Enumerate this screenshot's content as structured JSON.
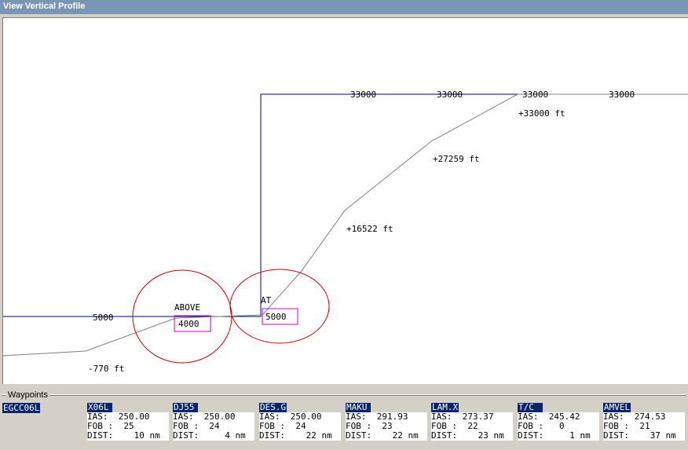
{
  "window": {
    "title": "View Vertical Profile"
  },
  "colors": {
    "profile_line": "#00008b",
    "descent_path": "#808080",
    "constraint_circle": "#cc0000",
    "constraint_box": "#cc00cc",
    "selected": "#08246b"
  },
  "profile": {
    "altitude_labels": [
      "33000",
      "33000",
      "33000",
      "33000"
    ],
    "left_altitude_label": "5000",
    "altitude_callouts": [
      "+33000 ft",
      "+27259 ft",
      "+16522 ft",
      "-770 ft"
    ],
    "constraints": [
      {
        "type_label": "ABOVE",
        "altitude": "4000"
      },
      {
        "type_label": "AT",
        "altitude": "5000"
      }
    ]
  },
  "waypoints_panel": {
    "legend": "Waypoints",
    "origin": "EGCC06L",
    "items": [
      {
        "name": "X06L",
        "ias": "IAS:  250.00",
        "fob": "FOB :  25",
        "dist": "DIST:    10 nm"
      },
      {
        "name": "DJ55",
        "ias": "IAS:  250.00",
        "fob": "FOB :  24",
        "dist": "DIST:     4 nm"
      },
      {
        "name": "DES.G",
        "ias": "IAS:  250.00",
        "fob": "FOB :  24",
        "dist": "DIST:    22 nm"
      },
      {
        "name": "MAKU",
        "ias": "IAS:  291.93",
        "fob": "FOB :  23",
        "dist": "DIST:    22 nm"
      },
      {
        "name": "LAM.X",
        "ias": "IAS:  273.37",
        "fob": "FOB :  22",
        "dist": "DIST:    23 nm"
      },
      {
        "name": "T/C",
        "ias": "IAS:  245.42",
        "fob": "FOB :   0",
        "dist": "DIST:     1 nm"
      },
      {
        "name": "AMVEL",
        "ias": "IAS:  274.53",
        "fob": "FOB :  21",
        "dist": "DIST:    37 nm"
      }
    ]
  }
}
